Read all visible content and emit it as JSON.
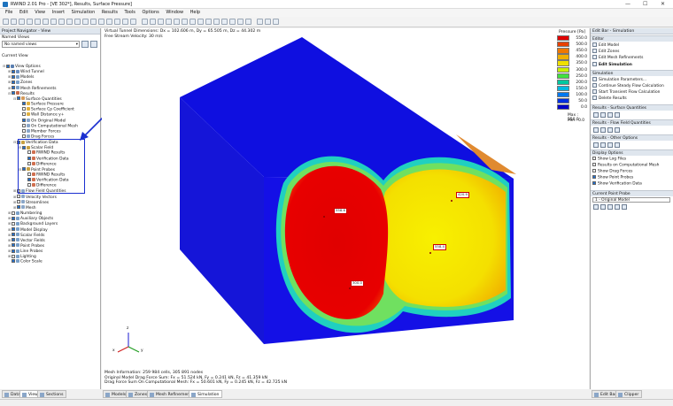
{
  "window": {
    "title": "RWIND 2.01 Pro - [VE 302*], Results, Surface Pressure]",
    "controls": [
      "—",
      "☐",
      "✕"
    ]
  },
  "menu": [
    "File",
    "Edit",
    "View",
    "Insert",
    "Simulation",
    "Results",
    "Tools",
    "Options",
    "Window",
    "Help"
  ],
  "left_panel": {
    "header": "Project Navigator - View",
    "named_views_label": "Named Views",
    "named_views_value": "No named views",
    "current_view_label": "Current View",
    "tree": [
      {
        "label": "View Options",
        "indent": 0,
        "checked": true,
        "expander": "⊟",
        "icon": "#5b7fb0"
      },
      {
        "label": "Wind Tunnel",
        "indent": 1,
        "checked": true,
        "expander": "⊞",
        "icon": "#6b8fbf"
      },
      {
        "label": "Models",
        "indent": 1,
        "checked": true,
        "expander": "⊞",
        "icon": "#7aa0c8"
      },
      {
        "label": "Zones",
        "indent": 1,
        "checked": true,
        "expander": "⊞",
        "icon": "#7aa0c8"
      },
      {
        "label": "Mesh Refinements",
        "indent": 1,
        "checked": true,
        "expander": "⊞",
        "icon": "#7aa0c8"
      },
      {
        "label": "Results",
        "indent": 1,
        "checked": true,
        "expander": "⊟",
        "icon": "#c86a4a"
      },
      {
        "label": "Surface Quantities",
        "indent": 2,
        "checked": true,
        "expander": "⊟",
        "icon": "#d49a5a"
      },
      {
        "label": "Surface Pressure",
        "indent": 3,
        "checked": true,
        "expander": "",
        "icon": "#e0b040"
      },
      {
        "label": "Surface Cp Coefficient",
        "indent": 3,
        "checked": false,
        "expander": "",
        "icon": "#e0b040"
      },
      {
        "label": "Wall Distance y+",
        "indent": 3,
        "checked": false,
        "expander": "",
        "icon": "#e0b040"
      },
      {
        "label": "On Original Model",
        "indent": 3,
        "checked": true,
        "expander": "",
        "icon": "#8aa6c8"
      },
      {
        "label": "On Computational Mesh",
        "indent": 3,
        "checked": false,
        "expander": "",
        "icon": "#8aa6c8"
      },
      {
        "label": "Member Forces",
        "indent": 3,
        "checked": false,
        "expander": "",
        "icon": "#8aa6c8"
      },
      {
        "label": "Drag Forces",
        "indent": 3,
        "checked": false,
        "expander": "",
        "icon": "#8aa6c8"
      },
      {
        "label": "Verification Data",
        "indent": 2,
        "checked": true,
        "expander": "⊟",
        "icon": "#c8a040"
      },
      {
        "label": "Scalar Field",
        "indent": 3,
        "checked": true,
        "expander": "⊟",
        "icon": "#c8a040"
      },
      {
        "label": "RWIND Results",
        "indent": 4,
        "checked": false,
        "expander": "",
        "icon": "#d07050"
      },
      {
        "label": "Verification Data",
        "indent": 4,
        "checked": true,
        "expander": "",
        "icon": "#d07050"
      },
      {
        "label": "Difference",
        "indent": 4,
        "checked": false,
        "expander": "",
        "icon": "#d07050"
      },
      {
        "label": "Point Probes",
        "indent": 3,
        "checked": true,
        "expander": "⊟",
        "icon": "#c8a040"
      },
      {
        "label": "RWIND Results",
        "indent": 4,
        "checked": false,
        "expander": "",
        "icon": "#d07050"
      },
      {
        "label": "Verification Data",
        "indent": 4,
        "checked": true,
        "expander": "",
        "icon": "#d07050"
      },
      {
        "label": "Difference",
        "indent": 4,
        "checked": false,
        "expander": "",
        "icon": "#d07050"
      },
      {
        "label": "Flow Field Quantities",
        "indent": 2,
        "checked": false,
        "expander": "⊞",
        "icon": "#8aa6c8"
      },
      {
        "label": "Velocity Vectors",
        "indent": 2,
        "checked": false,
        "expander": "⊞",
        "icon": "#8aa6c8"
      },
      {
        "label": "Streamlines",
        "indent": 2,
        "checked": false,
        "expander": "⊞",
        "icon": "#8aa6c8"
      },
      {
        "label": "Mesh",
        "indent": 2,
        "checked": true,
        "expander": "⊞",
        "icon": "#8aa6c8"
      },
      {
        "label": "Numbering",
        "indent": 1,
        "checked": false,
        "expander": "⊞",
        "icon": "#7aa0c8"
      },
      {
        "label": "Auxiliary Objects",
        "indent": 1,
        "checked": true,
        "expander": "⊞",
        "icon": "#7aa0c8"
      },
      {
        "label": "Background Layers",
        "indent": 1,
        "checked": false,
        "expander": "⊞",
        "icon": "#7aa0c8"
      },
      {
        "label": "Model Display",
        "indent": 1,
        "checked": true,
        "expander": "⊞",
        "icon": "#7aa0c8"
      },
      {
        "label": "Scalar Fields",
        "indent": 1,
        "checked": true,
        "expander": "⊞",
        "icon": "#7aa0c8"
      },
      {
        "label": "Vector Fields",
        "indent": 1,
        "checked": true,
        "expander": "⊞",
        "icon": "#7aa0c8"
      },
      {
        "label": "Point Probes",
        "indent": 1,
        "checked": true,
        "expander": "⊞",
        "icon": "#7aa0c8"
      },
      {
        "label": "Line Probes",
        "indent": 1,
        "checked": true,
        "expander": "⊞",
        "icon": "#7aa0c8"
      },
      {
        "label": "Lighting",
        "indent": 1,
        "checked": false,
        "expander": "⊞",
        "icon": "#7aa0c8"
      },
      {
        "label": "Color Scale",
        "indent": 1,
        "checked": true,
        "expander": "",
        "icon": "#7aa0c8"
      }
    ],
    "bottom_tabs": [
      "Data",
      "View",
      "Sections"
    ]
  },
  "viewport": {
    "info_lines": [
      "Virtual Tunnel Dimensions: Dx = 102.606 m, Dy = 65.505 m, Dz = 44.302 m",
      "Free Stream Velocity: 30 m/s"
    ],
    "bottom_lines": [
      "Mesh Information: 259 984 cells, 305 891 nodes",
      "Original Model Drag Force Sum: Fx = 51.524 kN, Fy = 0.241 kN, Fz = 41.359 kN",
      "Drag Force Sum On Computational Mesh: Fx = 50.601 kN, Fy = 0.245 kN, Fz = 42.725 kN"
    ],
    "tags": [
      "558.6",
      "420.9",
      "558.4",
      "300.0"
    ],
    "axis_labels": [
      "z",
      "x",
      "y"
    ]
  },
  "legend": {
    "title": "Pressure [Pa]",
    "rows": [
      {
        "color": "#e00000",
        "value": "550.0"
      },
      {
        "color": "#e84000",
        "value": "500.0"
      },
      {
        "color": "#f07800",
        "value": "450.0"
      },
      {
        "color": "#f0b000",
        "value": "400.0"
      },
      {
        "color": "#f0e000",
        "value": "350.0"
      },
      {
        "color": "#c8f000",
        "value": "300.0"
      },
      {
        "color": "#40e040",
        "value": "250.0"
      },
      {
        "color": "#00c8a0",
        "value": "200.0"
      },
      {
        "color": "#00b8e0",
        "value": "150.0"
      },
      {
        "color": "#0078f0",
        "value": "100.0"
      },
      {
        "color": "#0030e0",
        "value": "50.0"
      },
      {
        "color": "#0000c8",
        "value": "0.0"
      }
    ],
    "max_label": "Max :",
    "max_value": "550.0",
    "min_label": "Min :",
    "min_value": "0.0"
  },
  "right_panel": {
    "header": "Edit Bar - Simulation",
    "sections": [
      {
        "title": "Editor",
        "items": [
          "Edit Model",
          "Edit Zones",
          "Edit Mesh Refinements",
          "Edit Simulation"
        ]
      },
      {
        "title": "Simulation",
        "items": [
          "Simulation Parameters...",
          "Continue Steady Flow Calculation",
          "Start Transient Flow Calculation",
          "Delete Results"
        ]
      },
      {
        "title": "Results - Surface Quantities",
        "items": []
      },
      {
        "title": "Results - Flow Field Quantities",
        "items": []
      },
      {
        "title": "Results - Other Options",
        "items": []
      },
      {
        "title": "Display Options",
        "items": [
          "Show Log Files",
          "Results on Computational Mesh",
          "Show Drag Forces",
          "Show Point Probes",
          "Show Verification Data"
        ]
      },
      {
        "title": "Current Point Probe",
        "items": [
          "1 - Original Model"
        ]
      }
    ],
    "bottom_tabs": [
      "Edit Bar",
      "Clipper"
    ]
  },
  "viewport_tabs": [
    "Models",
    "Zones",
    "Mesh Refinements",
    "Simulation"
  ]
}
